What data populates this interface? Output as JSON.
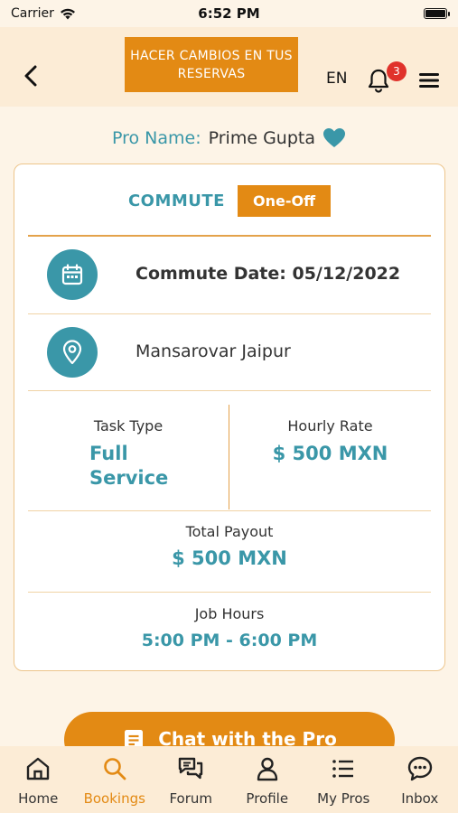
{
  "status": {
    "carrier": "Carrier",
    "time": "6:52 PM"
  },
  "header": {
    "banner": "HACER CAMBIOS EN TUS RESERVAS",
    "language": "EN",
    "notification_count": "3"
  },
  "pro": {
    "label": "Pro Name:",
    "name": "Prime Gupta"
  },
  "booking": {
    "service_type": "COMMUTE",
    "frequency": "One-Off",
    "date_text": "Commute Date: 05/12/2022",
    "location": "Mansarovar  Jaipur",
    "task_type_label": "Task Type",
    "task_type_line1": "Full",
    "task_type_line2": "Service",
    "hourly_rate_label": "Hourly Rate",
    "hourly_rate": "$ 500 MXN",
    "total_payout_label": "Total Payout",
    "total_payout": "$ 500 MXN",
    "job_hours_label": "Job Hours",
    "job_hours": "5:00 PM - 6:00 PM"
  },
  "chat_button": "Chat with the Pro",
  "tabs": [
    {
      "label": "Home",
      "icon": "home-icon"
    },
    {
      "label": "Bookings",
      "icon": "search-icon",
      "active": true
    },
    {
      "label": "Forum",
      "icon": "chat-bubbles-icon"
    },
    {
      "label": "Profile",
      "icon": "user-icon"
    },
    {
      "label": "My Pros",
      "icon": "list-icon"
    },
    {
      "label": "Inbox",
      "icon": "message-icon"
    }
  ],
  "colors": {
    "accent": "#e38a14",
    "teal": "#3a97a8",
    "background": "#fdf4e7",
    "header": "#fcecd6"
  }
}
